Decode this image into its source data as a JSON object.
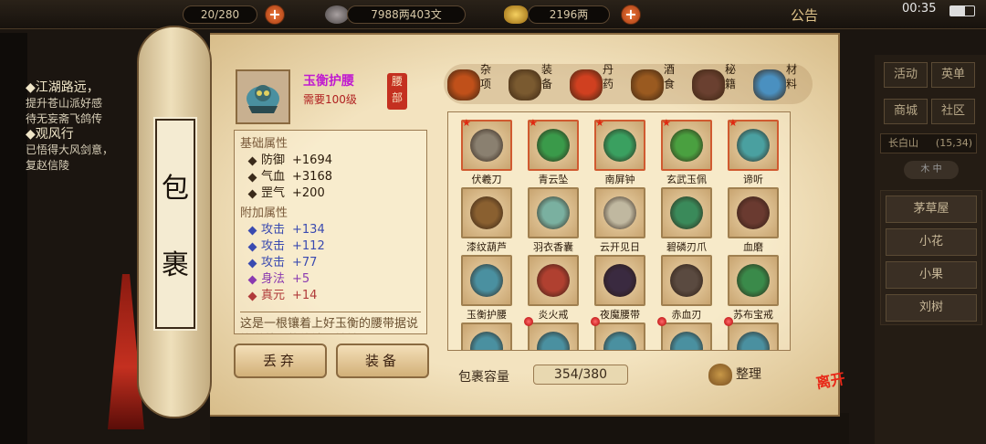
{
  "topbar": {
    "resource1": "20/280",
    "silver": "7988两403文",
    "gold": "2196两",
    "notice": "公告",
    "time": "00:35"
  },
  "quest": {
    "h1": "江湖路远，",
    "l1": "提升苍山派好感",
    "l2": "待无妄斋飞鸽传",
    "h2": "观风行",
    "l3": "已悟得大风剑意，",
    "l4": "复赵信陵"
  },
  "scroll_label": [
    "包",
    "裹"
  ],
  "item": {
    "name": "玉衡护腰",
    "level": "需要100级",
    "slot": "腰部"
  },
  "tabs": [
    {
      "label": "杂项",
      "icon": "sundries-pot-icon",
      "color": "#c0501a"
    },
    {
      "label": "装备",
      "icon": "equipment-scroll-icon",
      "color": "#7a5a30"
    },
    {
      "label": "丹药",
      "icon": "pill-icon",
      "color": "#d04020"
    },
    {
      "label": "酒食",
      "icon": "wine-jar-icon",
      "color": "#9a5a20"
    },
    {
      "label": "秘籍",
      "icon": "books-icon",
      "color": "#6a4030"
    },
    {
      "label": "材料",
      "icon": "crystal-icon",
      "color": "#4a90c0"
    }
  ],
  "stats": {
    "base_title": "基础属性",
    "base": [
      {
        "name": "防御",
        "value": "+1694"
      },
      {
        "name": "气血",
        "value": "+3168"
      },
      {
        "name": "罡气",
        "value": "+200"
      }
    ],
    "extra_title": "附加属性",
    "extra": [
      {
        "name": "攻击",
        "value": "+134",
        "color": "#3a4ab0"
      },
      {
        "name": "攻击",
        "value": "+112",
        "color": "#3a4ab0"
      },
      {
        "name": "攻击",
        "value": "+77",
        "color": "#3a4ab0"
      },
      {
        "name": "身法",
        "value": "+5",
        "color": "#8a3ab0"
      },
      {
        "name": "真元",
        "value": "+14",
        "color": "#b03a3a"
      }
    ],
    "description": "这是一根镶着上好玉衡的腰带据说能滋养人的体魄与精神"
  },
  "buttons": {
    "discard": "丢弃",
    "equip": "装备"
  },
  "inventory": [
    {
      "name": "伏羲刀",
      "icon": "blade-icon",
      "color": "#8a8070",
      "red": true,
      "star": true,
      "dot": false
    },
    {
      "name": "青云坠",
      "icon": "jade-pendant-icon",
      "color": "#3a9a4a",
      "red": true,
      "star": true,
      "dot": false
    },
    {
      "name": "南屏钟",
      "icon": "bell-icon",
      "color": "#3aa060",
      "red": true,
      "star": true,
      "dot": false
    },
    {
      "name": "玄武玉佩",
      "icon": "jade-pendant-icon",
      "color": "#4aa040",
      "red": true,
      "star": true,
      "dot": false
    },
    {
      "name": "谛听",
      "icon": "beast-amulet-icon",
      "color": "#4aa0a0",
      "red": true,
      "star": true,
      "dot": false
    },
    {
      "name": "漆纹葫芦",
      "icon": "gourd-icon",
      "color": "#8a6030",
      "red": false,
      "star": false,
      "dot": false
    },
    {
      "name": "羽衣香囊",
      "icon": "sachet-icon",
      "color": "#7ab0a0",
      "red": false,
      "star": false,
      "dot": false
    },
    {
      "name": "云开见日",
      "icon": "bracelet-icon",
      "color": "#c0b8a0",
      "red": false,
      "star": false,
      "dot": false
    },
    {
      "name": "碧磷刃爪",
      "icon": "claw-icon",
      "color": "#3a8a5a",
      "red": false,
      "star": false,
      "dot": false
    },
    {
      "name": "血磨",
      "icon": "spiked-glove-icon",
      "color": "#6a3a30",
      "red": false,
      "star": false,
      "dot": false
    },
    {
      "name": "玉衡护腰",
      "icon": "belt-icon",
      "color": "#4a90a0",
      "red": false,
      "star": false,
      "dot": false
    },
    {
      "name": "炎火戒",
      "icon": "fire-ring-icon",
      "color": "#b04030",
      "red": false,
      "star": false,
      "dot": false
    },
    {
      "name": "夜魔腰带",
      "icon": "belt-icon",
      "color": "#3a2a40",
      "red": false,
      "star": false,
      "dot": false
    },
    {
      "name": "赤血刃",
      "icon": "dagger-icon",
      "color": "#5a4a40",
      "red": false,
      "star": false,
      "dot": false
    },
    {
      "name": "苏布宝戒",
      "icon": "ring-icon",
      "color": "#3a8a4a",
      "red": false,
      "star": false,
      "dot": false
    },
    {
      "name": "",
      "icon": "belt-icon",
      "color": "#4a90a0",
      "red": false,
      "star": false,
      "dot": false
    },
    {
      "name": "",
      "icon": "belt-icon",
      "color": "#4a90a0",
      "red": false,
      "star": false,
      "dot": true
    },
    {
      "name": "",
      "icon": "belt-icon",
      "color": "#4a90a0",
      "red": false,
      "star": false,
      "dot": true
    },
    {
      "name": "",
      "icon": "belt-icon",
      "color": "#4a90a0",
      "red": false,
      "star": false,
      "dot": true
    },
    {
      "name": "",
      "icon": "belt-icon",
      "color": "#4a90a0",
      "red": false,
      "star": false,
      "dot": true
    }
  ],
  "capacity": {
    "label": "包裹容量",
    "value": "354/380"
  },
  "sort_label": "整理",
  "leave_label": "离开",
  "right": {
    "buttons": [
      "活动",
      "英单",
      "商城",
      "社区"
    ],
    "location": "长白山",
    "coords": "(15,34)",
    "minimap": "木 中",
    "npcs": [
      "茅草屋",
      "小花",
      "小果",
      "刘树"
    ]
  }
}
